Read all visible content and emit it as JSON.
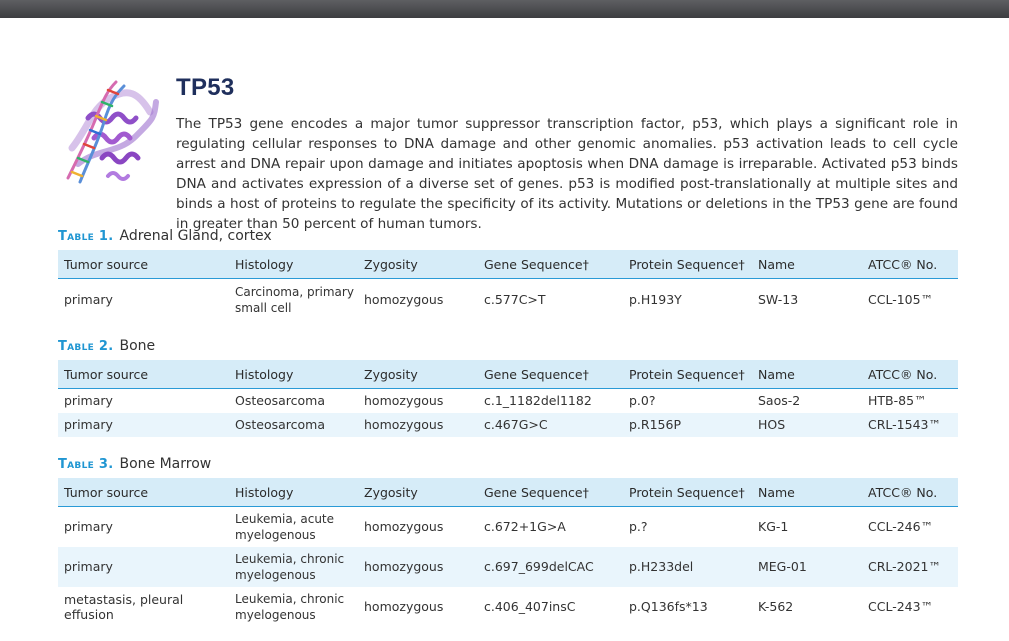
{
  "gene": {
    "title": "TP53",
    "intro": "The TP53 gene encodes a major tumor suppressor transcription factor, p53, which plays a significant role in regulating cellular responses to DNA damage and other genomic anomalies. p53 activation leads to cell cycle arrest and DNA repair upon damage and initiates apoptosis when DNA damage is irreparable. Activated p53 binds DNA and activates expression of a diverse set of genes. p53 is modified post-translationally at multiple sites and binds a host of proteins to regulate the specificity of its activity. Mutations or deletions in the TP53 gene are found in greater than 50 percent of human tumors."
  },
  "columns": [
    "Tumor source",
    "Histology",
    "Zygosity",
    "Gene Sequence†",
    "Protein Sequence†",
    "Name",
    "ATCC® No."
  ],
  "tables": [
    {
      "number": "Table 1.",
      "caption": "Adrenal Gland, cortex",
      "rows": [
        [
          "primary",
          "Carcinoma, primary small cell",
          "homozygous",
          "c.577C>T",
          "p.H193Y",
          "SW-13",
          "CCL-105™"
        ]
      ]
    },
    {
      "number": "Table 2.",
      "caption": "Bone",
      "rows": [
        [
          "primary",
          "Osteosarcoma",
          "homozygous",
          "c.1_1182del1182",
          "p.0?",
          "Saos-2",
          "HTB-85™"
        ],
        [
          "primary",
          "Osteosarcoma",
          "homozygous",
          "c.467G>C",
          "p.R156P",
          "HOS",
          "CRL-1543™"
        ]
      ]
    },
    {
      "number": "Table 3.",
      "caption": "Bone Marrow",
      "rows": [
        [
          "primary",
          "Leukemia, acute myelogenous",
          "homozygous",
          "c.672+1G>A",
          "p.?",
          "KG-1",
          "CCL-246™"
        ],
        [
          "primary",
          "Leukemia, chronic myelogenous",
          "homozygous",
          "c.697_699delCAC",
          "p.H233del",
          "MEG-01",
          "CRL-2021™"
        ],
        [
          "metastasis, pleural effusion",
          "Leukemia, chronic myelogenous",
          "homozygous",
          "c.406_407insC",
          "p.Q136fs*13",
          "K-562",
          "CCL-243™"
        ]
      ]
    }
  ]
}
